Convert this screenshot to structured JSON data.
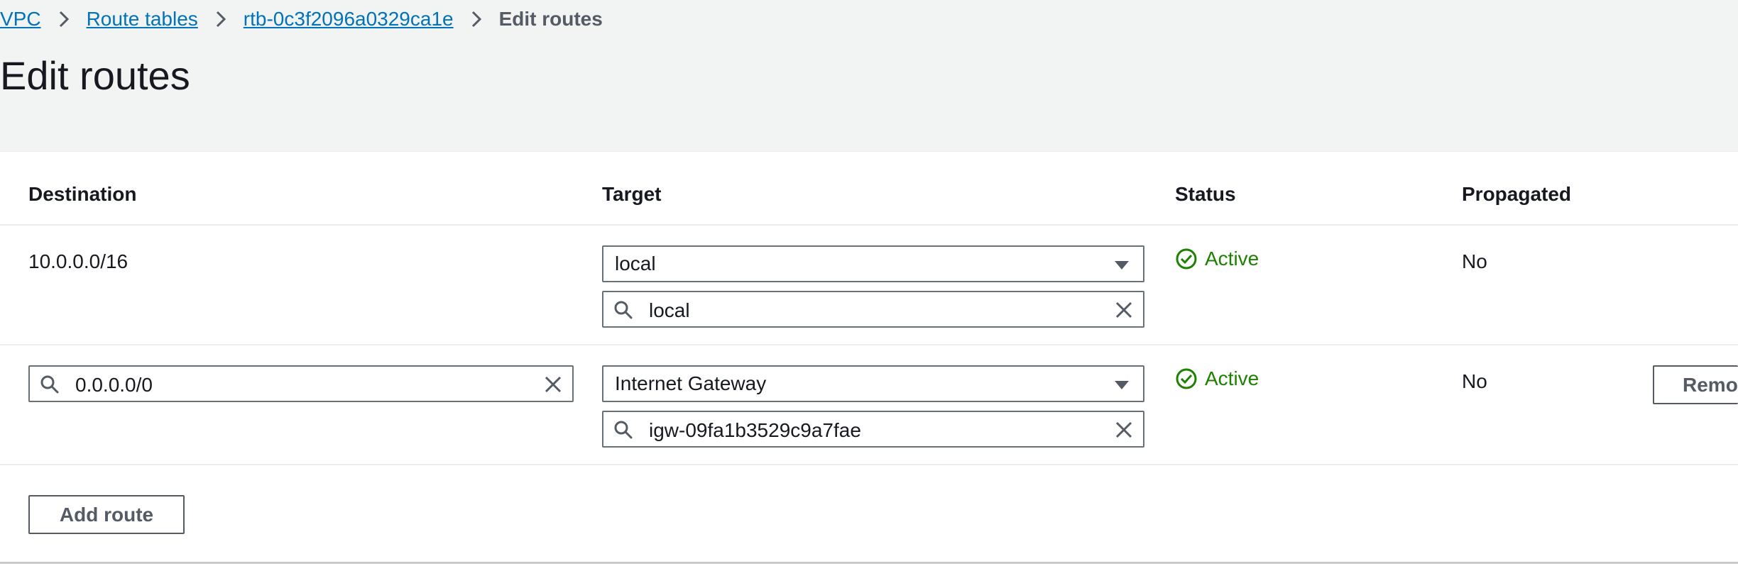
{
  "breadcrumb": {
    "items": [
      "VPC",
      "Route tables",
      "rtb-0c3f2096a0329ca1e"
    ],
    "current": "Edit routes"
  },
  "page": {
    "title": "Edit routes"
  },
  "table": {
    "headers": {
      "destination": "Destination",
      "target": "Target",
      "status": "Status",
      "propagated": "Propagated"
    },
    "rows": [
      {
        "destination": "10.0.0.0/16",
        "target_type": "local",
        "target_search": "local",
        "status": "Active",
        "propagated": "No"
      },
      {
        "destination": "0.0.0.0/0",
        "target_type": "Internet Gateway",
        "target_search": "igw-09fa1b3529c9a7fae",
        "status": "Active",
        "propagated": "No",
        "remove_label": "Remo"
      }
    ]
  },
  "actions": {
    "add_route_label": "Add route"
  },
  "icons": {
    "breadcrumb_separator": "chevron-right-icon",
    "select_caret": "caret-down-icon",
    "search": "search-icon",
    "clear": "close-icon",
    "status": "check-circle-icon"
  },
  "colors": {
    "link": "#0073bb",
    "success": "#1d8102",
    "header_bg": "#f2f3f3",
    "border": "#687078"
  }
}
